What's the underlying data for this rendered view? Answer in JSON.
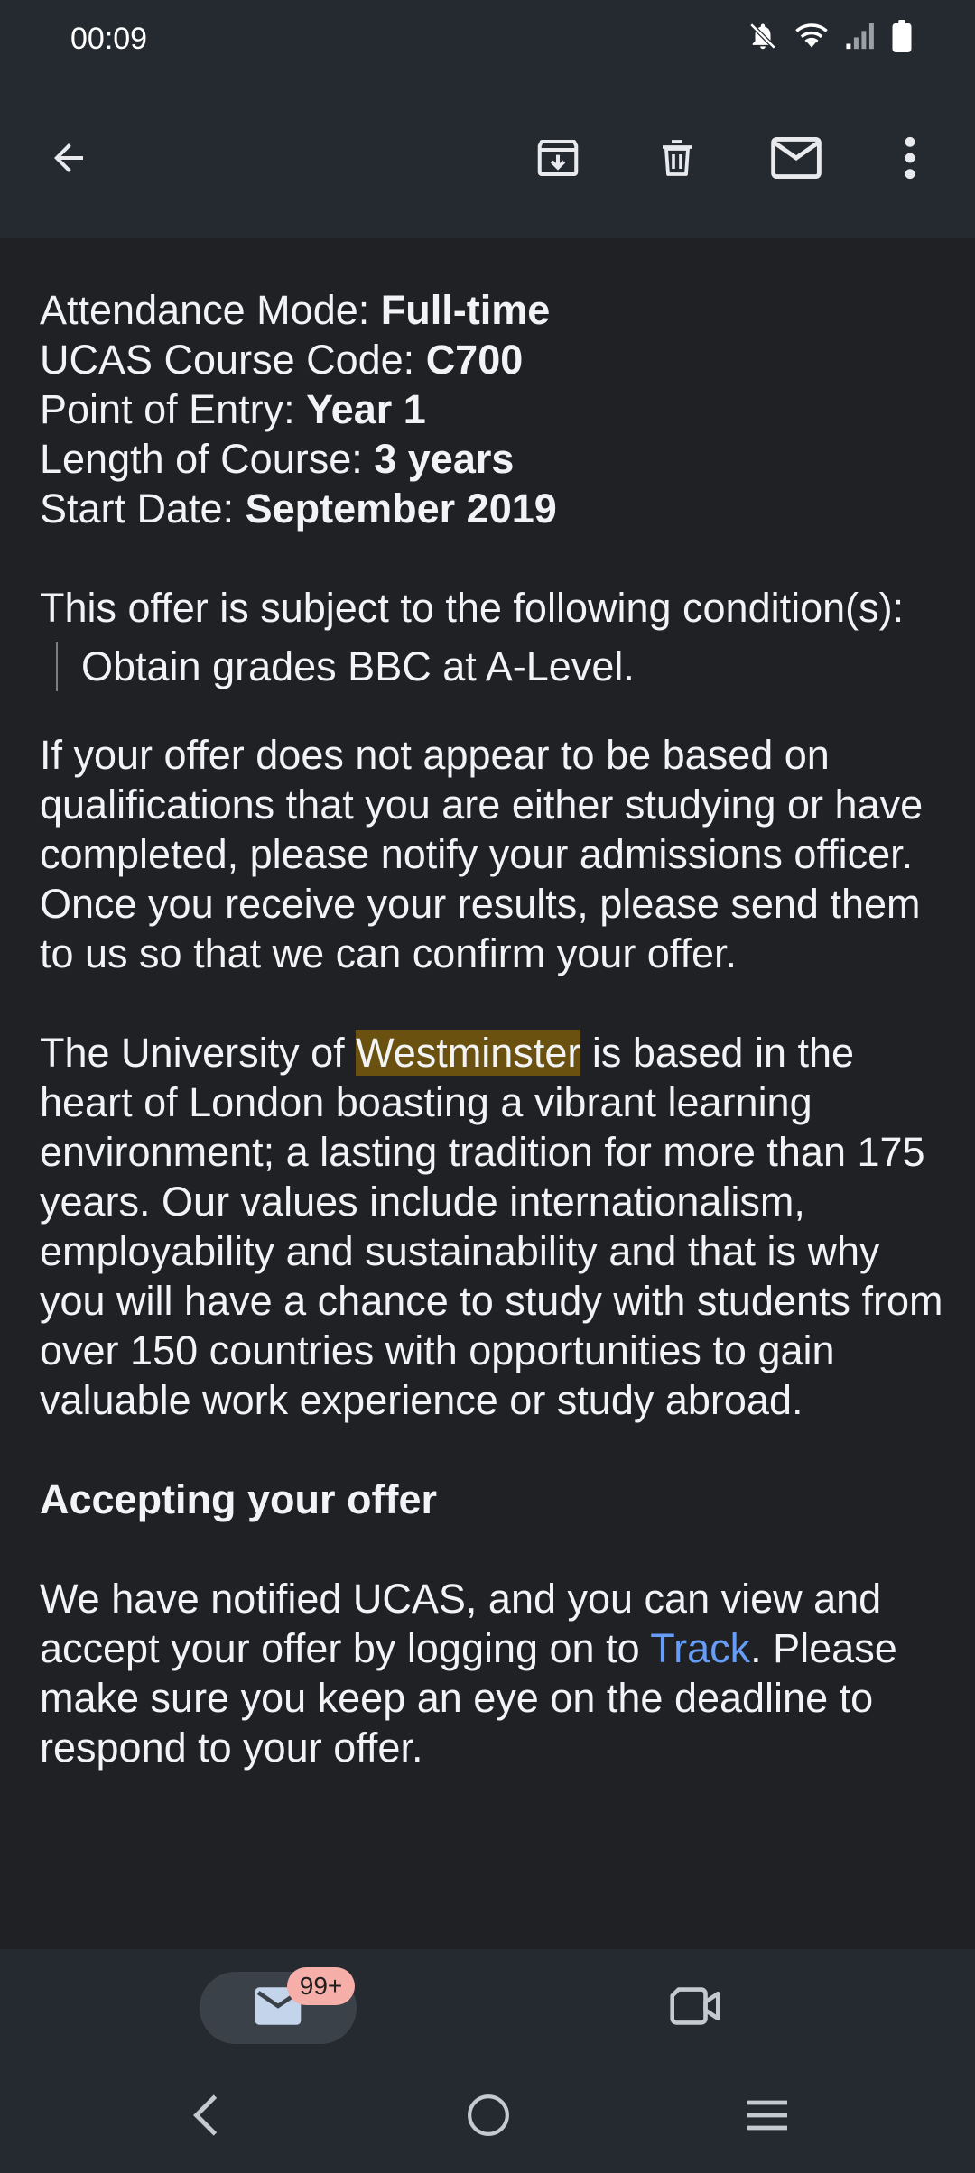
{
  "status_bar": {
    "time": "00:09",
    "icons": [
      "notifications-off-icon",
      "wifi-icon",
      "signal-icon",
      "battery-icon"
    ]
  },
  "toolbar": {
    "icons": [
      "back-arrow-icon",
      "archive-icon",
      "delete-icon",
      "mark-unread-icon",
      "more-options-icon"
    ]
  },
  "email": {
    "details": [
      {
        "label": "Attendance Mode: ",
        "value": "Full-time"
      },
      {
        "label": "UCAS Course Code: ",
        "value": "C700"
      },
      {
        "label": "Point of Entry: ",
        "value": "Year 1"
      },
      {
        "label": "Length of Course: ",
        "value": "3 years"
      },
      {
        "label": "Start Date: ",
        "value": "September 2019"
      }
    ],
    "condition_intro": "This offer is subject to the following condition(s):",
    "condition_quote": "Obtain grades BBC at A-Level.",
    "paragraph_results": "If your offer does not appear to be based on qualifications that you are either studying or have completed, please notify your admissions officer. Once you receive your results, please send them to us so that we can confirm your offer.",
    "paragraph_uni_before": "The University of ",
    "paragraph_uni_highlight": "Westminster",
    "paragraph_uni_after": " is based in the heart of London boasting a vibrant learning environment; a lasting tradition for more than 175 years. Our values include internationalism, employability and sustainability and that is why you will have a chance to study with students from over 150 countries with opportunities to gain valuable work experience or study abroad.",
    "heading_accept": "Accepting your offer",
    "paragraph_accept_before": "We have notified UCAS, and you can view and accept your offer by logging on to ",
    "paragraph_accept_link": "Track",
    "paragraph_accept_after": ". Please make sure you keep an eye on the deadline to respond to your offer."
  },
  "bottom_nav": {
    "mail_badge": "99+",
    "icons": [
      "mail-icon",
      "video-camera-icon"
    ]
  },
  "system_nav": {
    "icons": [
      "nav-back-icon",
      "nav-home-icon",
      "nav-recents-icon"
    ]
  },
  "colors": {
    "background": "#1f2124",
    "bar": "#252a30",
    "highlight": "#6b5110",
    "link": "#669df6",
    "badge": "#f6aea9"
  }
}
